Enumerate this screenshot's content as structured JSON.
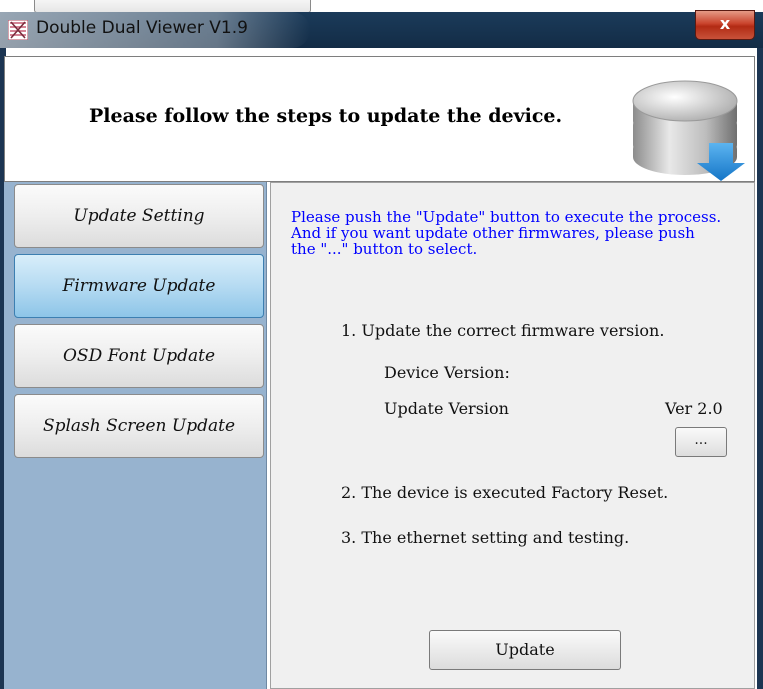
{
  "window": {
    "title": "Double Dual Viewer V1.9",
    "close_label": "x"
  },
  "header": {
    "instruction": "Please follow the steps to update the device."
  },
  "nav": {
    "items": [
      {
        "label": "Update Setting"
      },
      {
        "label": "Firmware Update",
        "active": true
      },
      {
        "label": "OSD Font Update"
      },
      {
        "label": "Splash Screen Update"
      }
    ]
  },
  "content": {
    "intro_lines": [
      "Please push the \"Update\" button to execute the process.",
      "And if you want update other firmwares, please push",
      "the \"...\" button to select."
    ],
    "step1": "1. Update the correct firmware version.",
    "device_version_label": "Device Version:",
    "update_version_label": "Update Version",
    "update_version_value": "Ver 2.0",
    "browse_label": "...",
    "step2": "2. The device is executed Factory Reset.",
    "step3": "3. The ethernet setting and testing.",
    "update_button": "Update"
  },
  "colors": {
    "titlebar": "#1b3b5a",
    "nav_background": "#97b3cf",
    "active_nav": "#b6dbf2",
    "intro_text": "#0000ff",
    "close_button": "#c9432c"
  },
  "icons": {
    "app": "app-icon",
    "header": "database-download-icon"
  }
}
